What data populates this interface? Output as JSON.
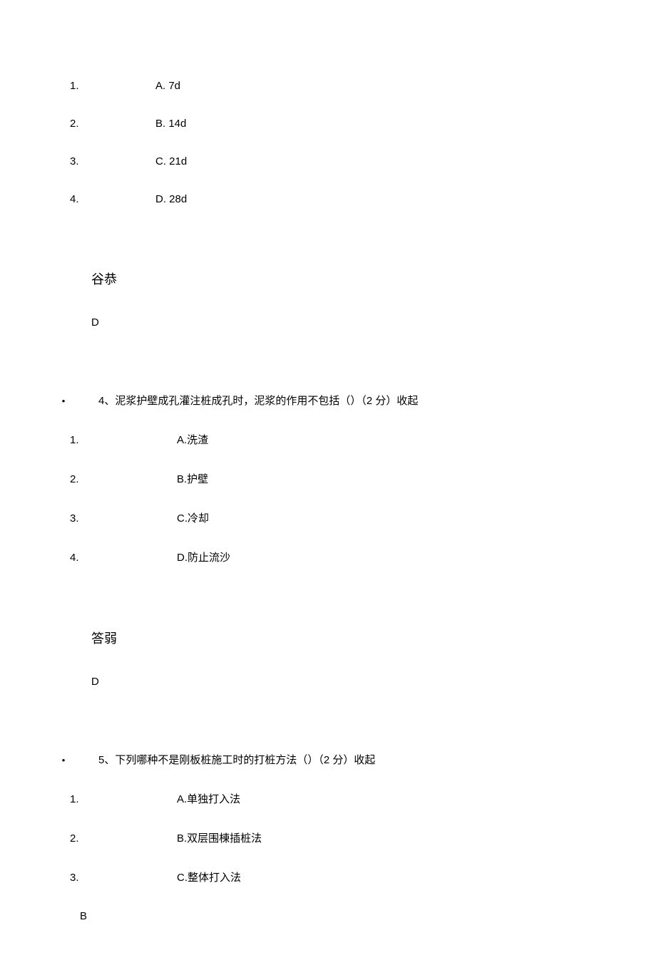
{
  "q3": {
    "options": [
      {
        "num": "1.",
        "text": "A.  7d"
      },
      {
        "num": "2.",
        "text": "B.  14d"
      },
      {
        "num": "3.",
        "text": "C.  21d"
      },
      {
        "num": "4.",
        "text": "D.  28d"
      }
    ],
    "answer_label": "谷恭",
    "answer_value": "D"
  },
  "q4": {
    "bullet": "•",
    "question": "4、泥浆护壁成孔灌注桩成孔时，泥浆的作用不包括（）（2 分）收起",
    "options": [
      {
        "num": "1.",
        "text": "A.洗渣"
      },
      {
        "num": "2.",
        "text": "B.护壁"
      },
      {
        "num": "3.",
        "text": "C.冷却"
      },
      {
        "num": "4.",
        "text": "D.防止流沙"
      }
    ],
    "answer_label": "答弱",
    "answer_value": "D"
  },
  "q5": {
    "bullet": "•",
    "question": "5、下列哪种不是刚板桩施工时的打桩方法（）（2 分）收起",
    "options": [
      {
        "num": "1.",
        "text": "A.单独打入法"
      },
      {
        "num": "2.",
        "text": "B.双层围棟插桩法"
      },
      {
        "num": "3.",
        "text": "C.整体打入法"
      }
    ],
    "trailing": "B"
  }
}
